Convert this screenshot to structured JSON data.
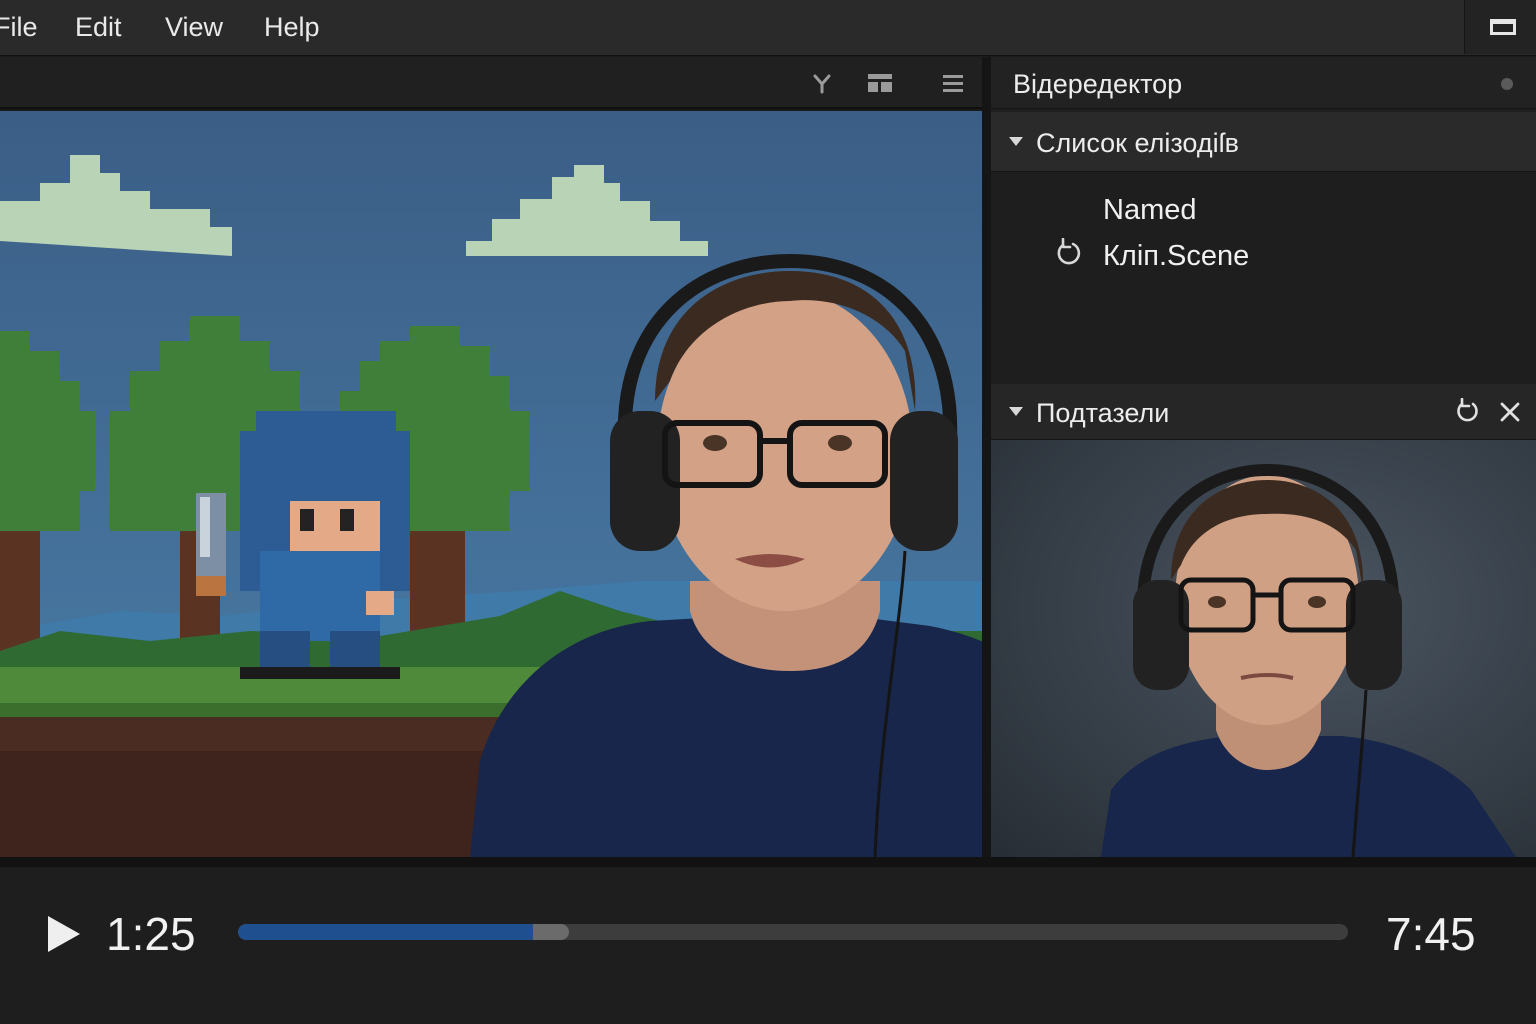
{
  "menubar": {
    "items": [
      "File",
      "Edit",
      "View",
      "Help"
    ]
  },
  "viewer_toolbar": {
    "icons": [
      "filter-icon",
      "layout-icon",
      "menu-icon"
    ]
  },
  "panel": {
    "title": "Відередектор",
    "episodes": {
      "header": "Слисок елізодіſв",
      "items": [
        {
          "label": "Named",
          "icon": ""
        },
        {
          "label": "Кліп.Scene",
          "icon": "refresh-icon"
        }
      ]
    },
    "subpanel": {
      "header": "Подтазели",
      "icons": [
        "refresh-icon",
        "close-icon"
      ]
    }
  },
  "transport": {
    "current_time": "1:25",
    "total_time": "7:45",
    "progress": 0.266,
    "buffered": 0.298
  },
  "colors": {
    "accent": "#1f4f8f",
    "background": "#1b1b1c",
    "sky": "#3a5f86"
  }
}
